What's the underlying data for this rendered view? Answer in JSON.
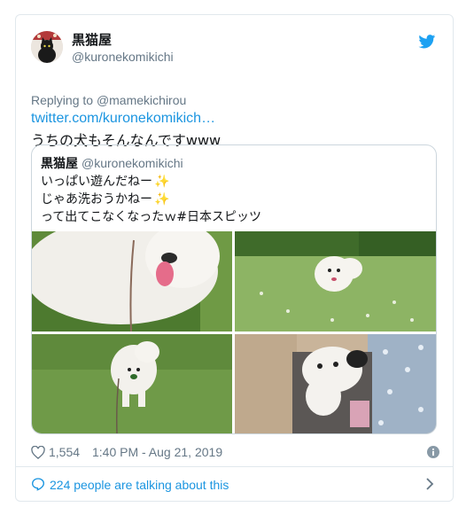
{
  "author": {
    "display_name": "黒猫屋",
    "handle": "@kuronekomikichi"
  },
  "reply": {
    "prefix": "Replying to",
    "to": "@mamekichirou"
  },
  "tweet": {
    "link_text": "twitter.com/kuronekomikich…",
    "text": "うちの犬もそんなんですwww"
  },
  "quoted": {
    "display_name": "黒猫屋",
    "handle": "@kuronekomikichi",
    "lines": [
      "いっぱい遊んだねー",
      "じゃあ洗おうかねー",
      "って出てこなくなったｗ#日本スピッツ"
    ],
    "sparkle": "✨",
    "photos": [
      "dog-closeup-photo",
      "dog-running-field-photo",
      "dog-standing-grass-photo",
      "dog-in-crate-photo"
    ]
  },
  "meta": {
    "likes": "1,554",
    "timestamp": "1:40 PM - Aug 21, 2019"
  },
  "footer": {
    "talking": "224 people are talking about this"
  },
  "colors": {
    "link": "#1b95e0",
    "secondary": "#657786",
    "border": "#e1e8ed"
  },
  "icons": [
    "twitter-bird-icon",
    "heart-icon",
    "info-icon",
    "speech-bubble-icon",
    "chevron-right-icon"
  ]
}
